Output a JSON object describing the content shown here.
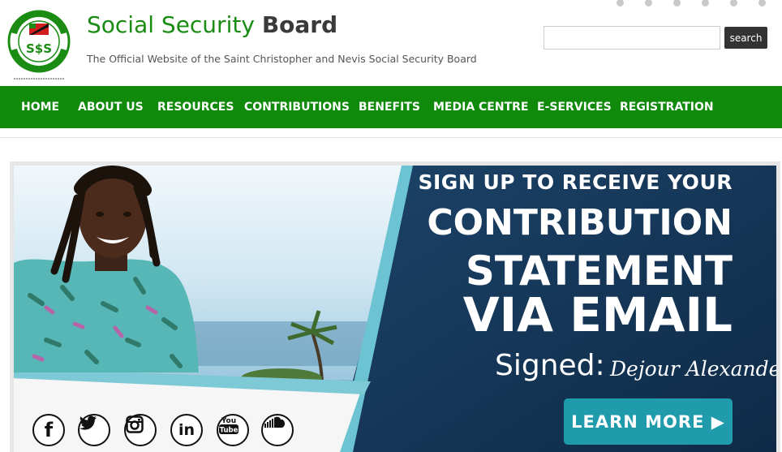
{
  "header": {
    "title_main": "Social Security",
    "title_bold": "Board",
    "tagline": "The Official Website of the Saint Christopher and Nevis Social Security Board",
    "logo_icon": "ssb-seal-logo",
    "search": {
      "placeholder": "",
      "value": "",
      "button_label": "search"
    }
  },
  "nav": {
    "items": [
      {
        "label": "HOME"
      },
      {
        "label": "ABOUT US"
      },
      {
        "label": "RESOURCES"
      },
      {
        "label": "CONTRIBUTIONS"
      },
      {
        "label": "BENEFITS"
      },
      {
        "label": "MEDIA CENTRE"
      },
      {
        "label": "E-SERVICES"
      },
      {
        "label": "REGISTRATION"
      }
    ]
  },
  "banner": {
    "line1": "SIGN UP TO RECEIVE YOUR",
    "line2": "CONTRIBUTION",
    "line3": "STATEMENT",
    "line4": "VIA EMAIL",
    "signed_label": "Signed:",
    "signature_text": "Dejour Alexander",
    "cta_label": "LEARN MORE ▶",
    "social_icons": [
      "facebook-icon",
      "twitter-icon",
      "instagram-icon",
      "linkedin-icon",
      "youtube-icon",
      "soundcloud-icon"
    ]
  },
  "colors": {
    "brand_green": "#0f8a0a",
    "title_green": "#1a8c14",
    "banner_navy": "#16385a",
    "cta_teal": "#1f9bab"
  }
}
